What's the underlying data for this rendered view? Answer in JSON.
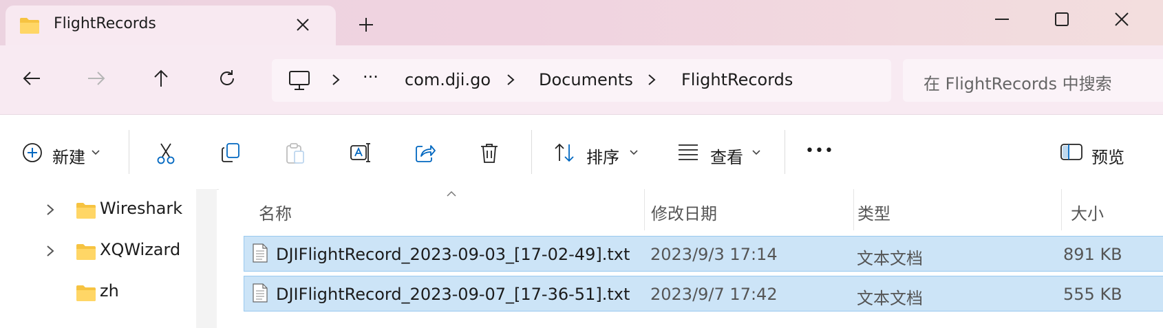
{
  "tab": {
    "title": "FlightRecords"
  },
  "window_controls": {
    "minimize": "minimize",
    "maximize": "maximize",
    "close": "close"
  },
  "address": {
    "segments": [
      "com.dji.go",
      "Documents",
      "FlightRecords"
    ],
    "overflow": "···"
  },
  "search": {
    "placeholder": "在 FlightRecords 中搜索"
  },
  "commands": {
    "new_label": "新建",
    "sort_label": "排序",
    "view_label": "查看",
    "more_label": "•••",
    "preview_label": "预览"
  },
  "nav_pane": {
    "items": [
      {
        "name": "Wireshark",
        "expandable": true
      },
      {
        "name": "XQWizard",
        "expandable": true
      },
      {
        "name": "zh",
        "expandable": false
      }
    ]
  },
  "file_list": {
    "columns": [
      "名称",
      "修改日期",
      "类型",
      "大小"
    ],
    "rows": [
      {
        "name": "DJIFlightRecord_2023-09-03_[17-02-49].txt",
        "date": "2023/9/3 17:14",
        "type": "文本文档",
        "size": "891 KB",
        "selected": true
      },
      {
        "name": "DJIFlightRecord_2023-09-07_[17-36-51].txt",
        "date": "2023/9/7 17:42",
        "type": "文本文档",
        "size": "555 KB",
        "selected": true
      }
    ]
  },
  "colors": {
    "titlebar": "#efd3e0",
    "navbar": "#f8eaf2",
    "selection": "#cce4f7",
    "selection_border": "#99c9ef",
    "accent": "#0067c0"
  },
  "icons": {
    "folder": "folder-icon",
    "file": "text-file-icon",
    "pc": "computer-icon"
  }
}
